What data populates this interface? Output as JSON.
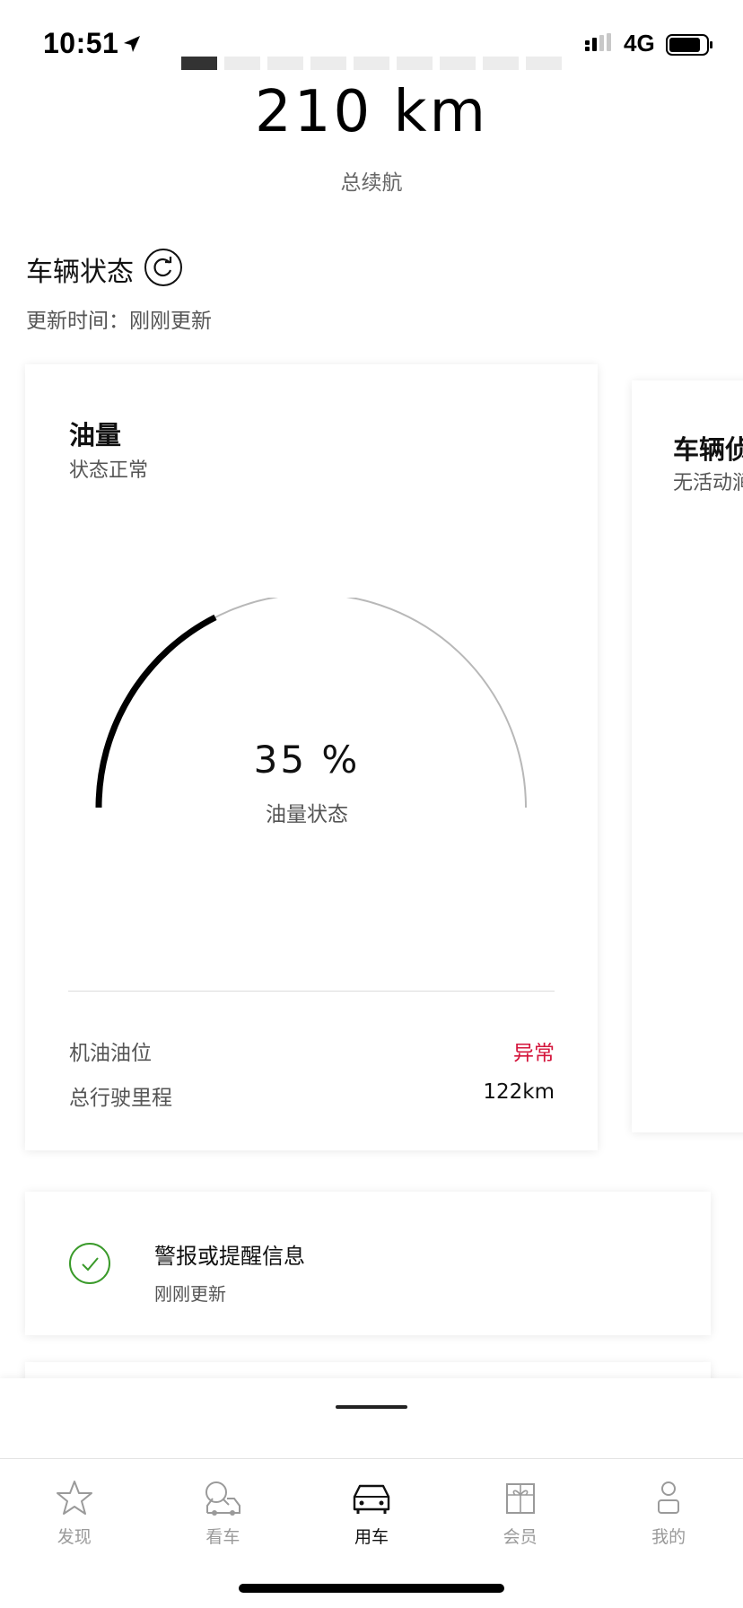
{
  "status_bar": {
    "time": "10:51",
    "network": "4G"
  },
  "pager": {
    "total": 9,
    "active_index": 0
  },
  "range": {
    "value": "210 km",
    "label": "总续航"
  },
  "vehicle_status": {
    "title": "车辆状态",
    "update_line": "更新时间：刚刚更新"
  },
  "fuel_card": {
    "title": "油量",
    "subtitle": "状态正常",
    "gauge_value": "35 %",
    "gauge_fraction": 0.35,
    "gauge_label": "油量状态",
    "rows": [
      {
        "label": "机油油位",
        "value": "异常"
      },
      {
        "label": "总行驶里程",
        "value": "122km"
      }
    ]
  },
  "side_card": {
    "title": "车辆侦",
    "subtitle": "无活动涧"
  },
  "alert_card": {
    "title": "警报或提醒信息",
    "subtitle": "刚刚更新"
  },
  "tabs": [
    {
      "label": "发现",
      "icon": "star-icon"
    },
    {
      "label": "看车",
      "icon": "car-search-icon"
    },
    {
      "label": "用车",
      "icon": "car-front-icon"
    },
    {
      "label": "会员",
      "icon": "gift-icon"
    },
    {
      "label": "我的",
      "icon": "person-icon"
    }
  ],
  "colors": {
    "alert": "#d4143b",
    "check": "#3a9a2a",
    "gauge_track": "#b8b8b8",
    "gauge_fill": "#000000"
  }
}
